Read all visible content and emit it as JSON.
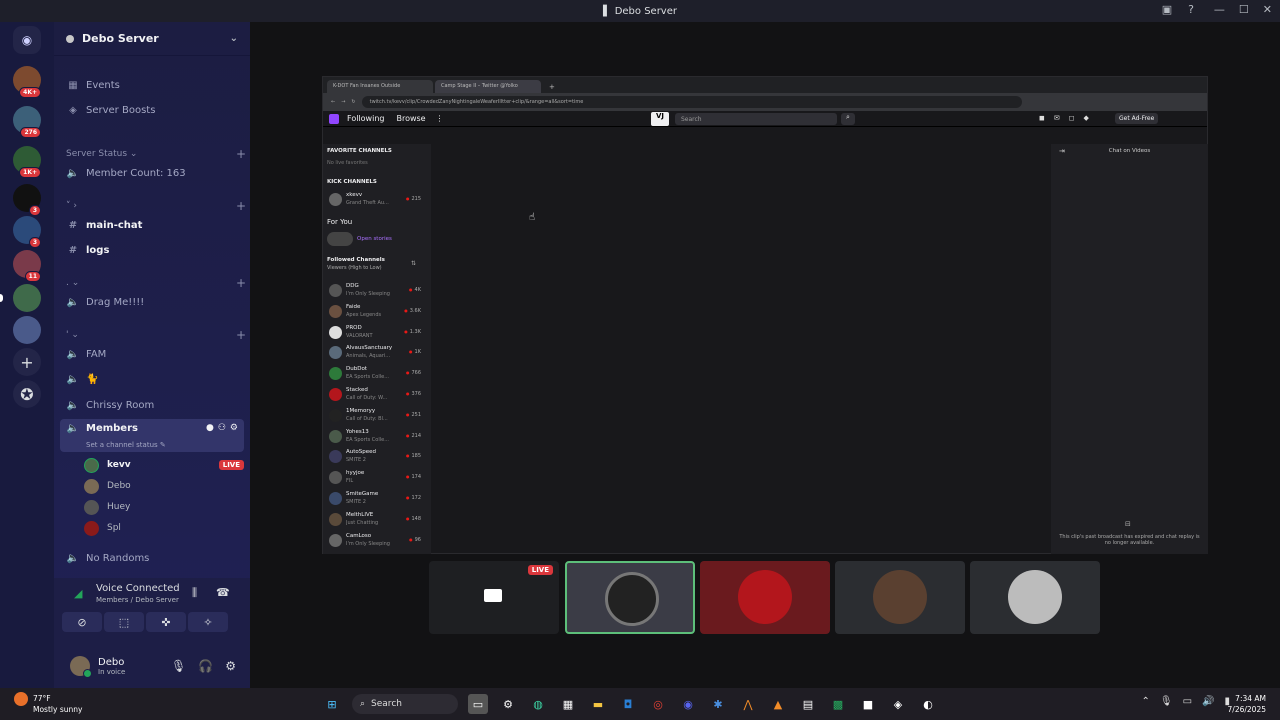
{
  "window": {
    "title": "Debo Server"
  },
  "rail": {
    "badges": [
      "4K+",
      "276",
      "1K+",
      "3",
      "3",
      "11"
    ]
  },
  "sidebar": {
    "server_name": "Debo Server",
    "events_label": "Events",
    "boosts_label": "Server Boosts",
    "server_status_category": "Server Status",
    "member_count": "Member Count: 163",
    "channels": [
      {
        "label": "main-chat"
      },
      {
        "label": "logs"
      },
      {
        "label": "Drag Me!!!!"
      },
      {
        "label": "FAM"
      },
      {
        "label": "🐈"
      },
      {
        "label": "Chrissy Room"
      },
      {
        "label": "Members"
      },
      {
        "label": "No Randoms"
      }
    ],
    "channel_status": "Set a channel status",
    "members": [
      {
        "name": "kevv",
        "live": "LIVE"
      },
      {
        "name": "Debo"
      },
      {
        "name": "Huey"
      },
      {
        "name": "Spl"
      }
    ]
  },
  "voice": {
    "status": "Voice Connected",
    "location": "Members / Debo Server"
  },
  "user": {
    "name": "Debo",
    "status": "In voice"
  },
  "stream": {
    "browser": {
      "tabs": [
        "K-DOT Fan Insanes Outside",
        "Camp Stage II – Twitter @Yolko"
      ],
      "url": "twitch.tv/kevv/clip/CrowdedZanyNightingaleWeaferIlltter+clip/&range=all&sort=time"
    },
    "twitch": {
      "nav": [
        "Following",
        "Browse"
      ],
      "search_placeholder": "Search",
      "ad_free": "Get Ad-Free",
      "favorite_channels": "FAVORITE CHANNELS",
      "no_favorites": "No live favorites",
      "kick_channels": "KICK CHANNELS",
      "kick_channel": {
        "name": "xkevv",
        "game": "Grand Theft Au...",
        "viewers": "215"
      },
      "for_you": "For You",
      "open_stories": "Open stories",
      "followed_title": "Followed Channels",
      "followed_sort": "Viewers (High to Low)",
      "channels": [
        {
          "name": "DDG",
          "game": "I'm Only Sleeping",
          "viewers": "4K"
        },
        {
          "name": "Faide",
          "game": "Apex Legends",
          "viewers": "3.6K"
        },
        {
          "name": "PROD",
          "game": "VALORANT",
          "viewers": "1.3K"
        },
        {
          "name": "AlvausSanctuary",
          "game": "Animals, Aquari...",
          "viewers": "1K"
        },
        {
          "name": "DubDot",
          "game": "EA Sports Colle...",
          "viewers": "766"
        },
        {
          "name": "Stacked",
          "game": "Call of Duty: W...",
          "viewers": "376"
        },
        {
          "name": "1Memoryy",
          "game": "Call of Duty: Bl...",
          "viewers": "251"
        },
        {
          "name": "Yohes13",
          "game": "EA Sports Colle...",
          "viewers": "214"
        },
        {
          "name": "AutoSpeed",
          "game": "SMITE 2",
          "viewers": "185"
        },
        {
          "name": "hyyjoe",
          "game": "FIL",
          "viewers": "174"
        },
        {
          "name": "SmiteGame",
          "game": "SMITE 2",
          "viewers": "172"
        },
        {
          "name": "MelthLIVE",
          "game": "Just Chatting",
          "viewers": "148"
        },
        {
          "name": "CamLoso",
          "game": "I'm Only Sleeping",
          "viewers": "96"
        }
      ],
      "chat_title": "Chat on Videos",
      "chat_message": "This clip's past broadcast has expired and chat replay is no longer available."
    }
  },
  "tiles": {
    "live_label": "LIVE"
  },
  "taskbar": {
    "temp": "77°F",
    "weather": "Mostly sunny",
    "search_label": "Search",
    "time": "7:34 AM",
    "date": "7/26/2025"
  },
  "colors": {
    "accent": "#5865f2",
    "live": "#da373c",
    "connected": "#23a55a",
    "twitch": "#9146ff"
  }
}
